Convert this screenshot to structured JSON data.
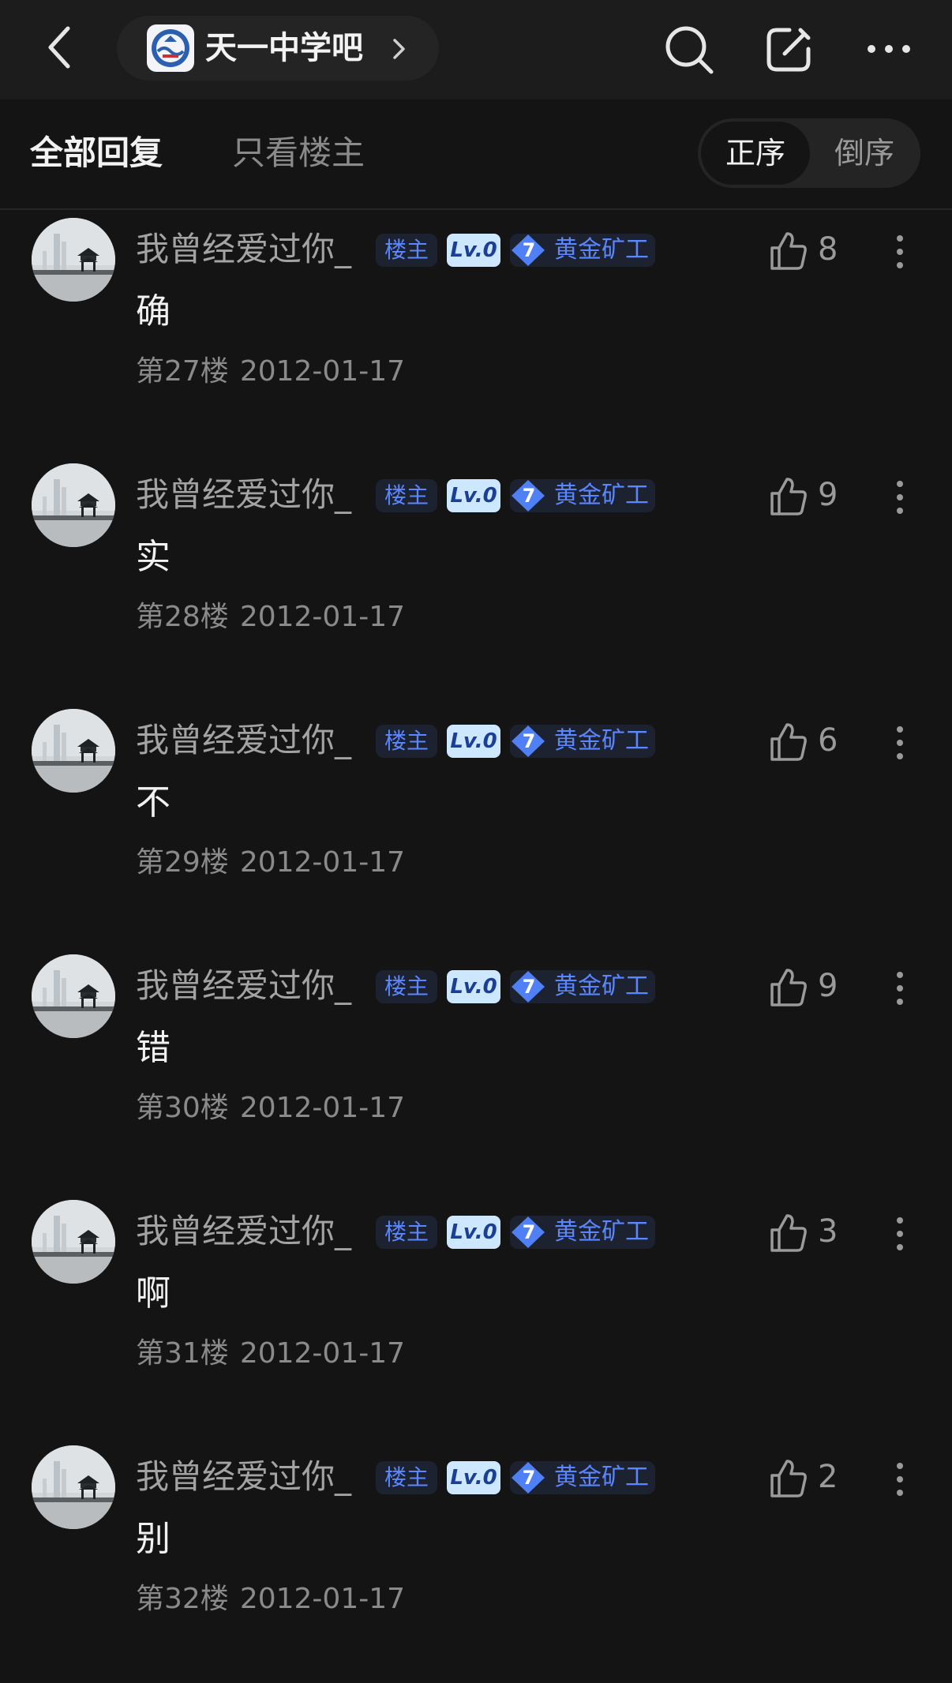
{
  "header": {
    "forum_name": "天一中学吧",
    "back_icon": "chevron-left-icon",
    "search_icon": "search-icon",
    "edit_icon": "edit-icon",
    "more_icon": "more-horizontal-icon"
  },
  "tabs": {
    "all_replies": "全部回复",
    "only_op": "只看楼主",
    "order_asc": "正序",
    "order_desc": "倒序"
  },
  "colors": {
    "background": "#141414",
    "badge_blue": "#5a86ff",
    "level_badge_bg": "#cde7ff"
  },
  "replies": [
    {
      "username": "我曾经爱过你_",
      "op_badge": "楼主",
      "level": "Lv.0",
      "rank_num": "7",
      "rank_title": "黄金矿工",
      "likes": "8",
      "text": "确",
      "floor": "第27楼",
      "date": "2012-01-17"
    },
    {
      "username": "我曾经爱过你_",
      "op_badge": "楼主",
      "level": "Lv.0",
      "rank_num": "7",
      "rank_title": "黄金矿工",
      "likes": "9",
      "text": "实",
      "floor": "第28楼",
      "date": "2012-01-17"
    },
    {
      "username": "我曾经爱过你_",
      "op_badge": "楼主",
      "level": "Lv.0",
      "rank_num": "7",
      "rank_title": "黄金矿工",
      "likes": "6",
      "text": "不",
      "floor": "第29楼",
      "date": "2012-01-17"
    },
    {
      "username": "我曾经爱过你_",
      "op_badge": "楼主",
      "level": "Lv.0",
      "rank_num": "7",
      "rank_title": "黄金矿工",
      "likes": "9",
      "text": "错",
      "floor": "第30楼",
      "date": "2012-01-17"
    },
    {
      "username": "我曾经爱过你_",
      "op_badge": "楼主",
      "level": "Lv.0",
      "rank_num": "7",
      "rank_title": "黄金矿工",
      "likes": "3",
      "text": "啊",
      "floor": "第31楼",
      "date": "2012-01-17"
    },
    {
      "username": "我曾经爱过你_",
      "op_badge": "楼主",
      "level": "Lv.0",
      "rank_num": "7",
      "rank_title": "黄金矿工",
      "likes": "2",
      "text": "别",
      "floor": "第32楼",
      "date": "2012-01-17"
    }
  ]
}
